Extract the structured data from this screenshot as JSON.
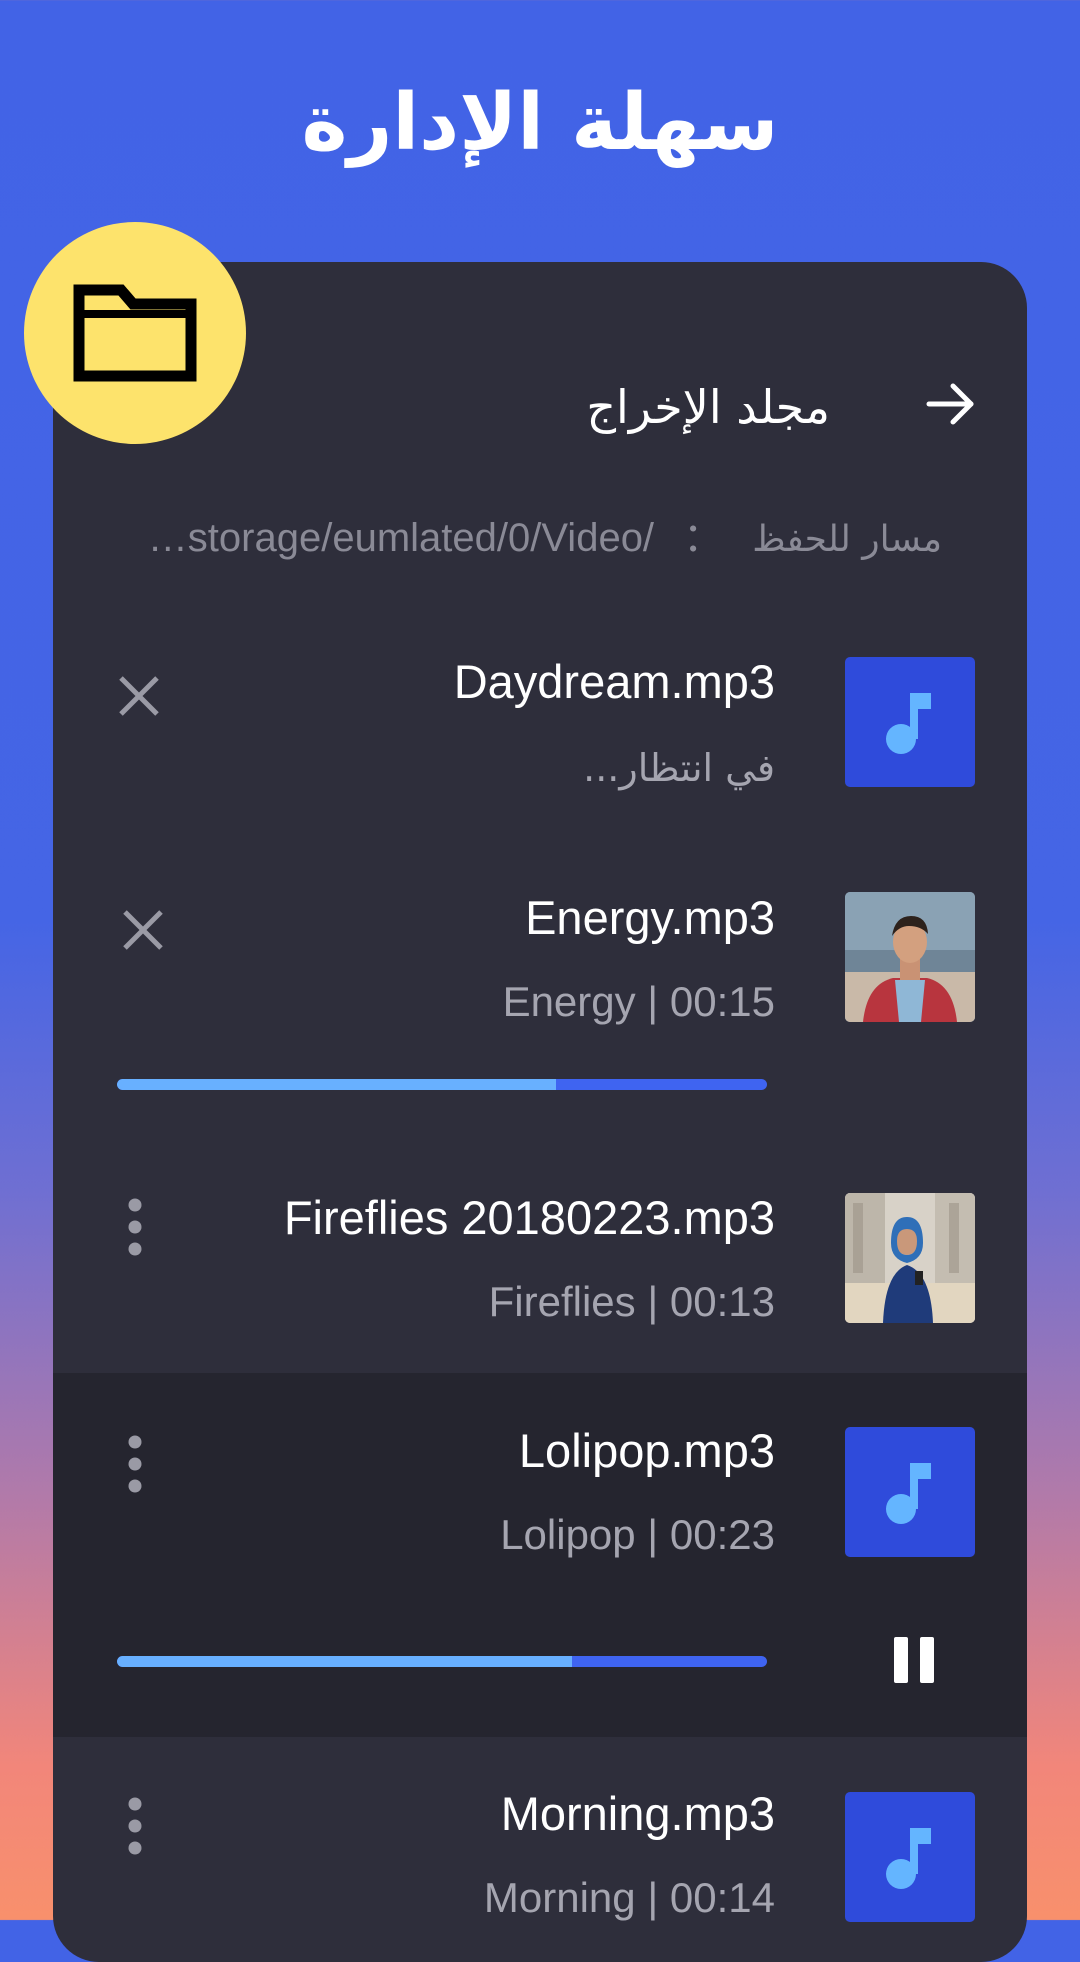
{
  "header": {
    "title": "سهلة الإدارة"
  },
  "output_folder": {
    "label": "مجلد الإخراج",
    "icons": {
      "folder": "folder-icon",
      "arrow": "arrow-right-icon"
    }
  },
  "save_path": {
    "label": "مسار للحفظ",
    "separator": "：",
    "value": "…storage/eumlated/0/Video/"
  },
  "items": [
    {
      "name": "Daydream.mp3",
      "subtitle": "في انتظار...",
      "thumb": "music-note-icon",
      "action": "close-icon"
    },
    {
      "name": "Energy.mp3",
      "subtitle": "Energy | 00:15",
      "thumb": "photo-man-plaid-shirt",
      "action": "close-icon",
      "progress": 0.675
    },
    {
      "name": "Fireflies 20180223.mp3",
      "subtitle": "Fireflies | 00:13",
      "thumb": "photo-woman-headscarf",
      "action": "more-vert-icon"
    },
    {
      "name": "Lolipop.mp3",
      "subtitle": "Lolipop | 00:23",
      "thumb": "music-note-icon",
      "action": "more-vert-icon",
      "progress": 0.7,
      "playing": true
    },
    {
      "name": "Morning.mp3",
      "subtitle": "Morning | 00:14",
      "thumb": "music-note-icon",
      "action": "more-vert-icon"
    }
  ],
  "colors": {
    "accent_blue": "#2f4bdb",
    "progress_done": "#68b0ff",
    "progress_track": "#3f64f1",
    "card_bg": "#2e2e3b",
    "badge_yellow": "#fde36c"
  }
}
